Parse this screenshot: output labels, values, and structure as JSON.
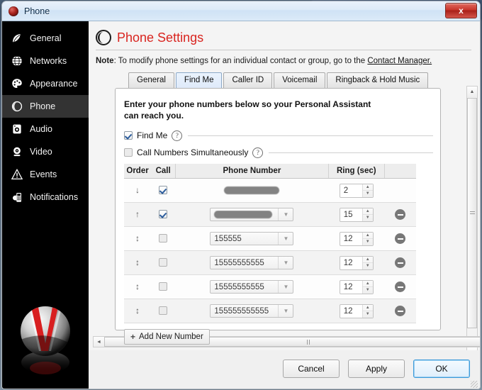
{
  "window": {
    "title": "Phone",
    "app_icon": "red-orb-icon",
    "close_label": "x"
  },
  "sidebar": {
    "items": [
      {
        "label": "General",
        "icon": "feather-icon",
        "active": false
      },
      {
        "label": "Networks",
        "icon": "globe-icon",
        "active": false
      },
      {
        "label": "Appearance",
        "icon": "palette-icon",
        "active": false
      },
      {
        "label": "Phone",
        "icon": "headset-icon",
        "active": true
      },
      {
        "label": "Audio",
        "icon": "speaker-icon",
        "active": false
      },
      {
        "label": "Video",
        "icon": "webcam-icon",
        "active": false
      },
      {
        "label": "Events",
        "icon": "warning-icon",
        "active": false
      },
      {
        "label": "Notifications",
        "icon": "mobile-phone-icon",
        "active": false
      }
    ],
    "logo": "v-sphere-logo"
  },
  "page": {
    "icon": "headset-icon",
    "title": "Phone Settings",
    "title_color": "#d9241f",
    "note_prefix": "Note",
    "note_text": ": To modify phone settings for an individual contact or group, go to the ",
    "note_link": "Contact Manager."
  },
  "tabs": [
    {
      "label": "General",
      "selected": false
    },
    {
      "label": "Find Me",
      "selected": true
    },
    {
      "label": "Caller ID",
      "selected": false
    },
    {
      "label": "Voicemail",
      "selected": false
    },
    {
      "label": "Ringback & Hold Music",
      "selected": false
    }
  ],
  "find_me": {
    "lead_line1": "Enter your phone numbers below so your Personal Assistant",
    "lead_line2": "can reach you.",
    "checkboxes": [
      {
        "label": "Find Me",
        "checked": true,
        "help": "?"
      },
      {
        "label": "Call Numbers Simultaneously",
        "checked": false,
        "help": "?"
      }
    ],
    "table": {
      "headers": [
        "Order",
        "Call",
        "Phone Number",
        "Ring (sec)",
        ""
      ],
      "rows": [
        {
          "order_icon": "arrow-down",
          "call": true,
          "number": "",
          "redacted": true,
          "redact_width": 78,
          "has_combo": false,
          "ring": "2",
          "deletable": false
        },
        {
          "order_icon": "arrow-up",
          "call": true,
          "number": "",
          "redacted": true,
          "redact_width": 82,
          "has_combo": true,
          "ring": "15",
          "deletable": true
        },
        {
          "order_icon": "arrow-up-down",
          "call": false,
          "number": "155555",
          "redacted": false,
          "redact_width": 0,
          "has_combo": true,
          "ring": "12",
          "deletable": true
        },
        {
          "order_icon": "arrow-up-down",
          "call": false,
          "number": "15555555555",
          "redacted": false,
          "redact_width": 0,
          "has_combo": true,
          "ring": "12",
          "deletable": true
        },
        {
          "order_icon": "arrow-up-down",
          "call": false,
          "number": "15555555555",
          "redacted": false,
          "redact_width": 0,
          "has_combo": true,
          "ring": "12",
          "deletable": true
        },
        {
          "order_icon": "arrow-up-down",
          "call": false,
          "number": "155555555555",
          "redacted": false,
          "redact_width": 0,
          "has_combo": true,
          "ring": "12",
          "deletable": true
        }
      ]
    },
    "add_button": {
      "plus": "+",
      "label": "Add New Number"
    }
  },
  "scrollbars": {
    "vertical": {
      "up": "▲",
      "down": "▼"
    },
    "horizontal": {
      "left": "◄",
      "right": "►"
    }
  },
  "footer": {
    "buttons": [
      {
        "label": "Cancel",
        "default": false
      },
      {
        "label": "Apply",
        "default": false
      },
      {
        "label": "OK",
        "default": true
      }
    ]
  }
}
